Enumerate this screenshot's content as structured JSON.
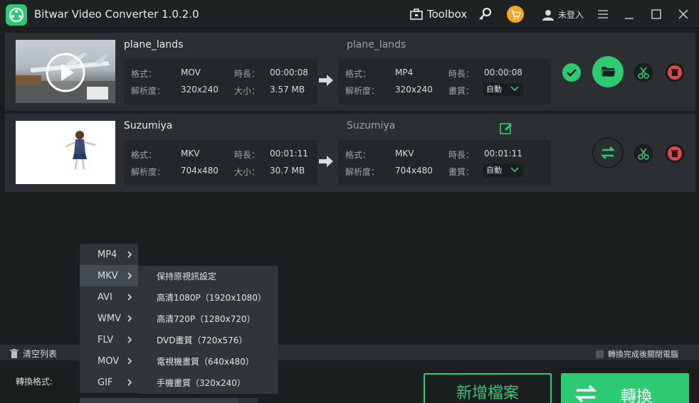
{
  "app": {
    "title": "Bitwar Video Converter  1.0.2.0"
  },
  "header": {
    "toolbox_label": "Toolbox",
    "login_label": "未登入"
  },
  "files": [
    {
      "source_name": "plane_lands",
      "output_name": "plane_lands",
      "source": {
        "format_label": "格式：",
        "format": "MOV",
        "duration_label": "時長：",
        "duration": "00:00:08",
        "resolution_label": "解析度：",
        "resolution": "320x240",
        "size_label": "大小：",
        "size": "3.57 MB"
      },
      "output": {
        "format_label": "格式：",
        "format": "MP4",
        "duration_label": "時長：",
        "duration": "00:00:08",
        "resolution_label": "解析度：",
        "resolution": "320x240",
        "quality_label": "畫質：",
        "quality": "自動"
      },
      "status": "completed"
    },
    {
      "source_name": "Suzumiya",
      "output_name": "Suzumiya",
      "source": {
        "format_label": "格式：",
        "format": "MKV",
        "duration_label": "時長：",
        "duration": "00:01:11",
        "resolution_label": "解析度：",
        "resolution": "704x480",
        "size_label": "大小：",
        "size": "30.7 MB"
      },
      "output": {
        "format_label": "格式：",
        "format": "MKV",
        "duration_label": "時長：",
        "duration": "00:01:11",
        "resolution_label": "解析度：",
        "resolution": "704x480",
        "quality_label": "畫質：",
        "quality": "自動"
      },
      "status": "pending"
    }
  ],
  "bottom": {
    "clear_list": "清空列表",
    "shutdown_label": "轉換完成後關閉電腦",
    "convert_format_label": "轉換格式:",
    "add_file": "新增檔案",
    "convert": "轉換"
  },
  "format_menu": {
    "items": [
      "MP4",
      "MKV",
      "AVI",
      "WMV",
      "FLV",
      "MOV",
      "GIF"
    ],
    "active": "MKV",
    "sub_items": [
      "保持原視訊設定",
      "高清1080P（1920x1080）",
      "高清720P（1280x720）",
      "DVD畫質（720x576）",
      "電視機畫質（640x480）",
      "手機畫質（320x240）"
    ]
  },
  "colors": {
    "accent": "#2eca72",
    "background": "#1b1e1f",
    "row": "#2b2f31",
    "danger": "#e04848",
    "cart": "#f5a623"
  },
  "icons": [
    "app-logo",
    "toolbox-icon",
    "search-key-icon",
    "cart-icon",
    "user-icon",
    "menu-icon",
    "minimize-icon",
    "maximize-icon",
    "close-icon",
    "play-icon",
    "arrow-right-icon",
    "check-icon",
    "folder-icon",
    "scissors-icon",
    "trash-icon",
    "convert-icon",
    "edit-icon",
    "chevron-right-icon"
  ]
}
